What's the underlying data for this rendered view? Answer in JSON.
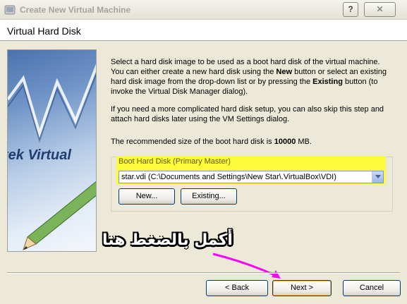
{
  "window": {
    "title": "Create New Virtual Machine",
    "help_label": "?",
    "close_label": "✕"
  },
  "page": {
    "title": "Virtual Hard Disk"
  },
  "side_image": {
    "text": "tek Virtual"
  },
  "description": {
    "p1_a": "Select a hard disk image to be used as a boot hard disk of the virtual machine. You can either create a new hard disk using the ",
    "p1_new": "New",
    "p1_b": " button or select an existing hard disk image from the drop-down list or by pressing the ",
    "p1_existing": "Existing",
    "p1_c": " button (to invoke the Virtual Disk Manager dialog).",
    "p2": "If you need a more complicated hard disk setup, you can also skip this step and attach hard disks later using the VM Settings dialog.",
    "p3_a": "The recommended size of the boot hard disk is ",
    "p3_size": "10000",
    "p3_b": " MB."
  },
  "boot_disk": {
    "legend": "Boot Hard Disk (Primary Master)",
    "selected": "star.vdi (C:\\Documents and Settings\\New Star\\.VirtualBox\\VDI)",
    "new_label": "New...",
    "existing_label": "Existing..."
  },
  "footer": {
    "back_label": "< Back",
    "next_label": "Next >",
    "cancel_label": "Cancel"
  },
  "annotation": {
    "text": "أكمل بالضغط هنا",
    "color": "#ff00ff"
  }
}
